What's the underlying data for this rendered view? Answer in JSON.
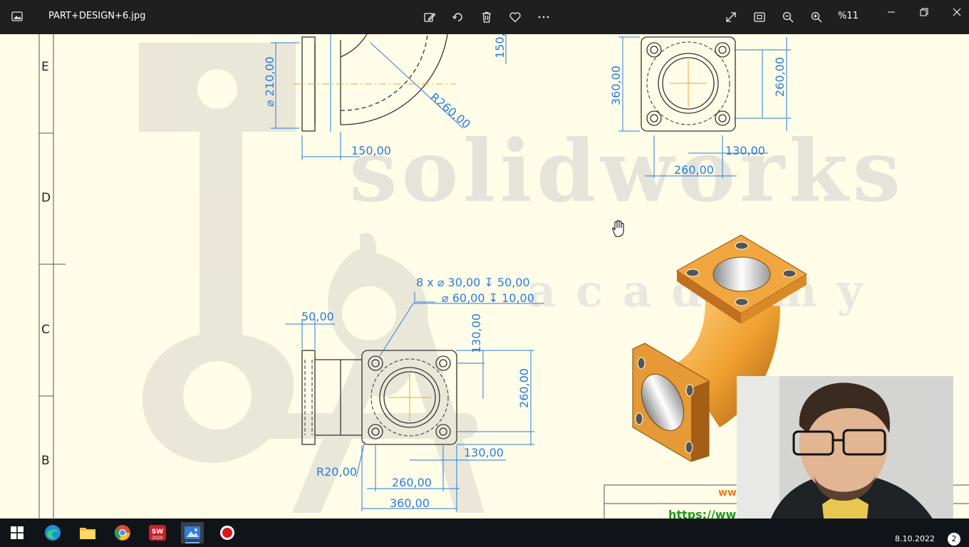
{
  "titlebar": {
    "filename": "PART+DESIGN+6.jpg",
    "zoom": "%11"
  },
  "drawing": {
    "row_letters": [
      "E",
      "D",
      "C",
      "B"
    ],
    "dims_top_left": [
      "210,00",
      "150,00",
      "R260,00",
      "150,"
    ],
    "dims_top_right": [
      "360,00",
      "260,00",
      "130,00",
      "260,00"
    ],
    "callout_line1": "8 x ⌀ 30,00 ↧ 50,00",
    "callout_line2": "⌀ 60,00 ↧ 10,00",
    "dims_bottom": [
      "50,00",
      "130,00",
      "260,00",
      "R20,00",
      "260,00",
      "130,00",
      "360,00"
    ],
    "watermark_main": "solidworks",
    "watermark_sub": "academy"
  },
  "footer": {
    "url_top": "ww",
    "url": "https://www"
  },
  "taskbar": {
    "date": "8.10.2022",
    "badge": "2"
  },
  "colors": {
    "titlebar": "#1f1f1f",
    "paper": "#fffde8",
    "dimension": "#2a7be0",
    "part_orange": "#f0a030",
    "taskbar": "#101418"
  }
}
